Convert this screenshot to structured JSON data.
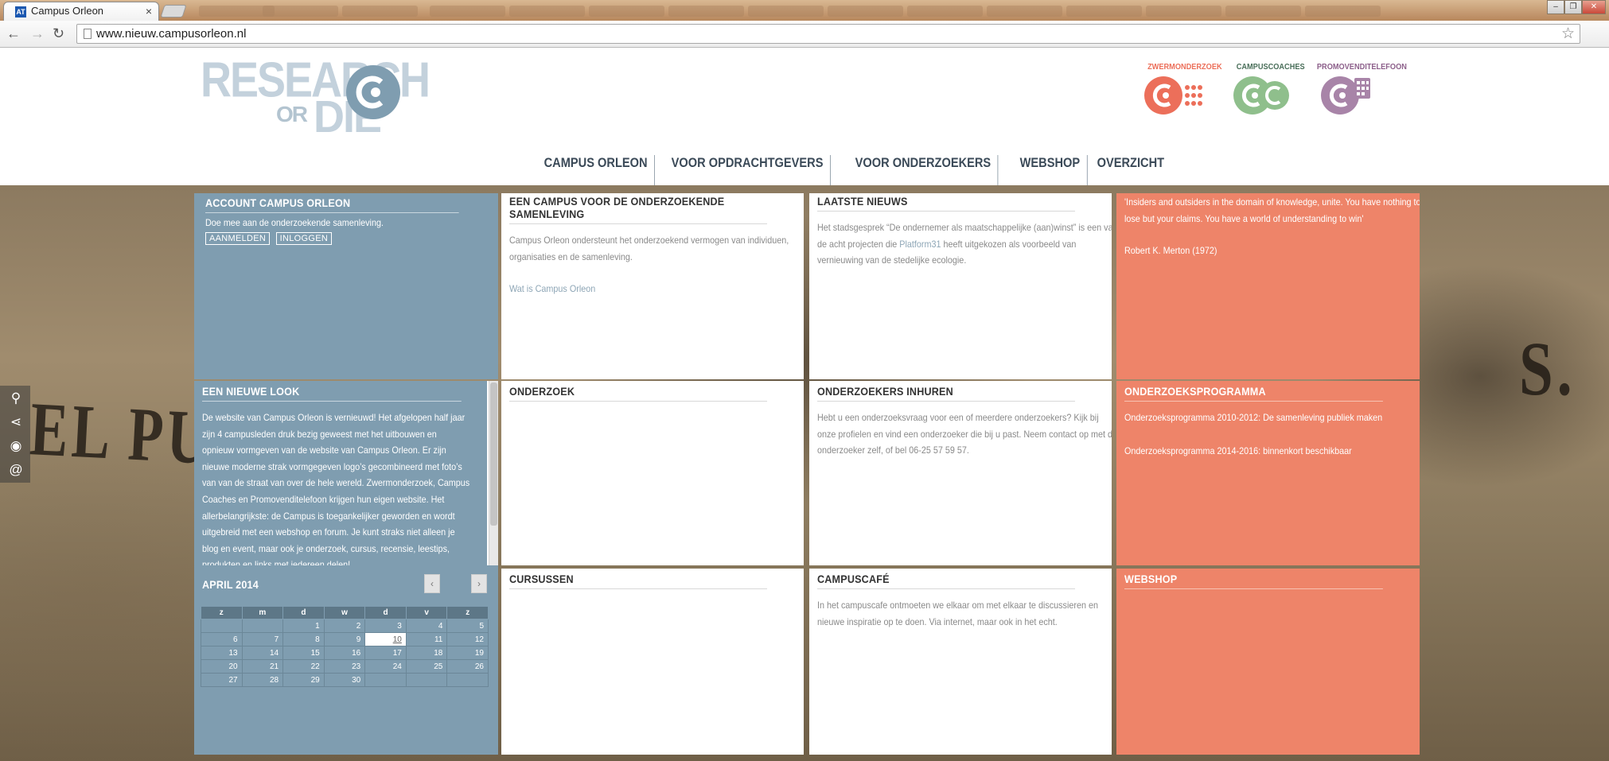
{
  "browser": {
    "active_tab_title": "Campus Orleon",
    "url": "www.nieuw.campusorleon.nl",
    "favicon_text": "AT",
    "close_glyph": "×",
    "window_buttons": [
      "–",
      "❐",
      "✕"
    ],
    "nav_glyphs": {
      "back": "←",
      "forward": "→",
      "reload": "↻",
      "star": "☆"
    }
  },
  "site": {
    "logo": {
      "line1": "RESEARCH",
      "line2": "OR",
      "line3": "DIE"
    },
    "sub_brands": [
      {
        "label": "ZWERMONDERZOEK",
        "color": "#ec6f5a"
      },
      {
        "label": "CAMPUSCOACHES",
        "color": "#4a6f5a"
      },
      {
        "label": "PROMOVENDITELEFOON",
        "color": "#8c5f8a"
      }
    ],
    "nav": [
      "CAMPUS ORLEON",
      "VOOR OPDRACHTGEVERS",
      "VOOR ONDERZOEKERS",
      "WEBSHOP",
      "OVERZICHT"
    ]
  },
  "side_tools": [
    "search-icon",
    "share-icon",
    "rss-icon",
    "at-icon"
  ],
  "side_tool_glyphs": [
    "⚲",
    "⋖",
    "◉",
    "@"
  ],
  "background_graffiti": [
    "EL PUE",
    "S."
  ],
  "panels": {
    "account": {
      "title": "ACCOUNT CAMPUS ORLEON",
      "text": "Doe mee aan de onderzoekende samenleving.",
      "register": "AANMELDEN",
      "login": "INLOGGEN"
    },
    "campus": {
      "title": "EEN CAMPUS VOOR DE ONDERZOEKENDE SAMENLEVING",
      "text": "Campus Orleon ondersteunt het onderzoekend vermogen van individuen, organisaties en de samenleving.",
      "link": "Wat is Campus Orleon"
    },
    "news": {
      "title": "LAATSTE NIEUWS",
      "text_before": "Het stadsgesprek “De ondernemer als maatschappelijke (aan)winst” is een van de acht projecten die ",
      "link": "Platform31",
      "text_after": " heeft uitgekozen als voorbeeld van vernieuwing van de stedelijke ecologie."
    },
    "quote": {
      "text": "'Insiders and outsiders in the domain of knowledge, unite. You have nothing to lose but your claims. You have a world of understanding to win'",
      "author": "Robert K. Merton (1972)"
    },
    "new_look": {
      "title": "EEN NIEUWE LOOK",
      "text": "De website van Campus Orleon is vernieuwd! Het afgelopen half jaar zijn 4 campusleden druk bezig geweest met het uitbouwen en opnieuw vormgeven van de website van Campus Orleon. Er zijn nieuwe moderne strak vormgegeven logo’s gecombineerd met foto’s van van de straat van over de hele wereld. Zwermonderzoek, Campus Coaches en Promovenditelefoon krijgen hun eigen website. Het allerbelangrijkste: de Campus is toegankelijker geworden en wordt uitgebreid met een webshop en forum. Je kunt straks niet alleen je blog en event, maar ook je onderzoek, cursus, recensie, leestips, produkten en links met iedereen delen!"
    },
    "research": {
      "title": "ONDERZOEK"
    },
    "hire": {
      "title": "ONDERZOEKERS INHUREN",
      "text": "Hebt u een onderzoeksvraag voor een of meerdere onderzoekers? Kijk bij onze profielen en vind een onderzoeker die bij u past. Neem contact op met de onderzoeker zelf, of bel 06-25 57 59 57."
    },
    "program": {
      "title": "ONDERZOEKSPROGRAMMA",
      "item1": "Onderzoeksprogramma 2010-2012: De samenleving publiek maken",
      "item2": "Onderzoeksprogramma 2014-2016: binnenkort beschikbaar"
    },
    "calendar": {
      "month": "APRIL 2014",
      "prev": "‹",
      "next": "›",
      "weekdays": [
        "z",
        "m",
        "d",
        "w",
        "d",
        "v",
        "z"
      ],
      "weeks": [
        [
          "",
          "",
          "1",
          "2",
          "3",
          "4",
          "5"
        ],
        [
          "6",
          "7",
          "8",
          "9",
          "10",
          "11",
          "12"
        ],
        [
          "13",
          "14",
          "15",
          "16",
          "17",
          "18",
          "19"
        ],
        [
          "20",
          "21",
          "22",
          "23",
          "24",
          "25",
          "26"
        ],
        [
          "27",
          "28",
          "29",
          "30",
          "",
          "",
          ""
        ]
      ],
      "today": "10"
    },
    "courses": {
      "title": "CURSUSSEN"
    },
    "cafe": {
      "title": "CAMPUSCAFÉ",
      "text": "In het campuscafe ontmoeten we elkaar om met elkaar te discussieren en nieuwe inspiratie op te doen. Via internet, maar ook in het echt."
    },
    "webshop": {
      "title": "WEBSHOP"
    }
  }
}
